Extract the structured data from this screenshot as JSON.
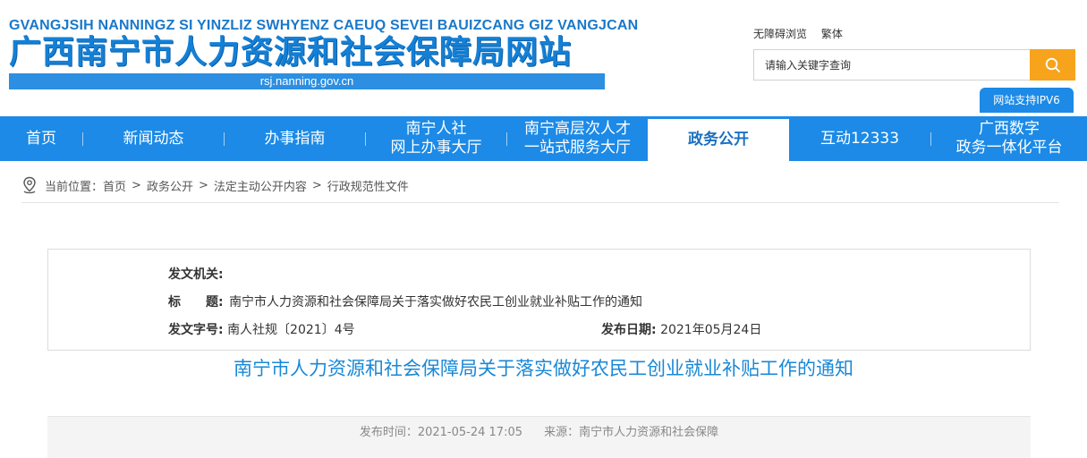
{
  "header": {
    "pinyin": "GVANGJSIH NANNINGZ SI YINZLIZ SWHYENZ CAEUQ SEVEI BAUIZCANG GIZ VANGJCAN",
    "title": "广西南宁市人力资源和社会保障局网站",
    "url": "rsj.nanning.gov.cn",
    "links": {
      "accessible": "无障碍浏览",
      "traditional": "繁体"
    },
    "search": {
      "placeholder": "请输入关键字查询",
      "icon": "search-icon"
    },
    "ipv6_label": "网站支持IPV6"
  },
  "nav": {
    "items": [
      {
        "label": "首页"
      },
      {
        "label": "新闻动态"
      },
      {
        "label": "办事指南"
      },
      {
        "line1": "南宁人社",
        "line2": "网上办事大厅"
      },
      {
        "line1": "南宁高层次人才",
        "line2": "一站式服务大厅"
      },
      {
        "label": "政务公开",
        "active": true
      },
      {
        "label": "互动12333"
      },
      {
        "line1": "广西数字",
        "line2": "政务一体化平台"
      }
    ]
  },
  "breadcrumb": {
    "icon": "location-pin-icon",
    "prefix": "当前位置：",
    "items": [
      "首页",
      "政务公开",
      "法定主动公开内容",
      "行政规范性文件"
    ],
    "separator": ">"
  },
  "info": {
    "issuer_label": "发文机关:",
    "issuer_value": "",
    "title_label_1": "标",
    "title_label_2": "题:",
    "title_value": "南宁市人力资源和社会保障局关于落实做好农民工创业就业补贴工作的通知",
    "docno_label": "发文字号:",
    "docno_value": "南人社规〔2021〕4号",
    "date_label": "发布日期:",
    "date_value": "2021年05月24日"
  },
  "article": {
    "title": "南宁市人力资源和社会保障局关于落实做好农民工创业就业补贴工作的通知",
    "publish_time": "发布时间：2021-05-24 17:05",
    "source": "来源：南宁市人力资源和社会保障"
  },
  "colors": {
    "primary": "#1c8ae6",
    "accent": "#f7a31c",
    "title_blue": "#1a88d6"
  }
}
